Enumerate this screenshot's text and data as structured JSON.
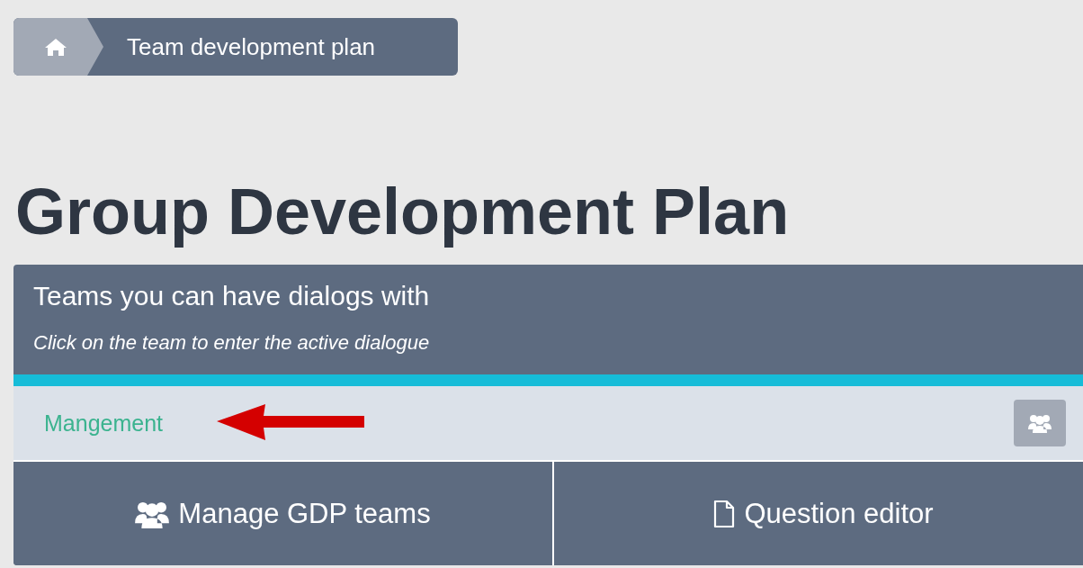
{
  "breadcrumb": {
    "items": [
      {
        "kind": "home"
      },
      {
        "kind": "text",
        "label": "Team development plan"
      }
    ]
  },
  "title": "Group Development Plan",
  "panel": {
    "heading": "Teams you can have dialogs with",
    "subheading": "Click on the team to enter the active dialogue",
    "teams": [
      {
        "name": "Mangement"
      }
    ],
    "actions": [
      {
        "kind": "users",
        "label": "Manage GDP teams"
      },
      {
        "kind": "file",
        "label": "Question editor"
      }
    ]
  }
}
